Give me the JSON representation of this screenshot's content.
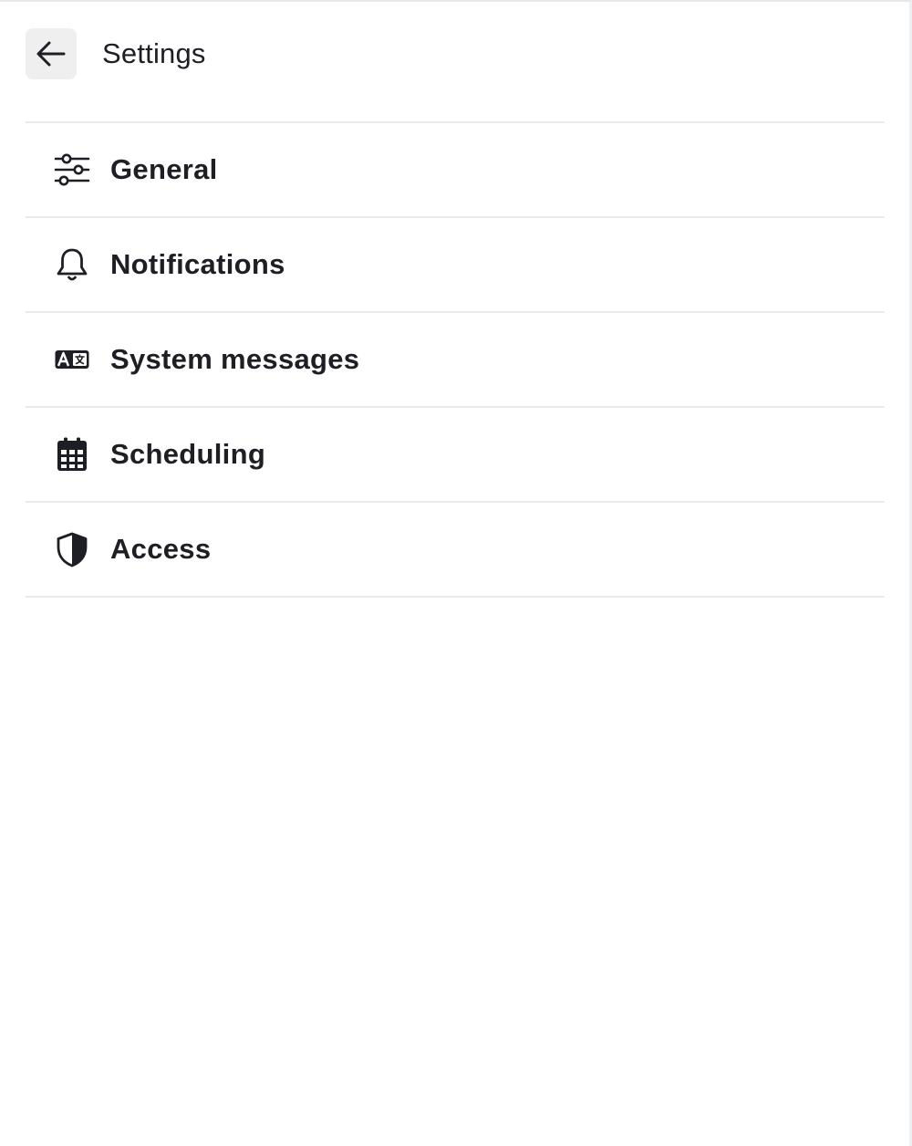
{
  "header": {
    "title": "Settings",
    "back_icon": "arrow-left-icon"
  },
  "menu": {
    "items": [
      {
        "label": "General",
        "icon": "sliders-icon"
      },
      {
        "label": "Notifications",
        "icon": "bell-icon"
      },
      {
        "label": "System messages",
        "icon": "language-badge-icon"
      },
      {
        "label": "Scheduling",
        "icon": "calendar-icon"
      },
      {
        "label": "Access",
        "icon": "shield-icon"
      }
    ]
  },
  "colors": {
    "text": "#1d1f24",
    "divider": "#e8e9ec",
    "back_button_bg": "#efefef"
  }
}
